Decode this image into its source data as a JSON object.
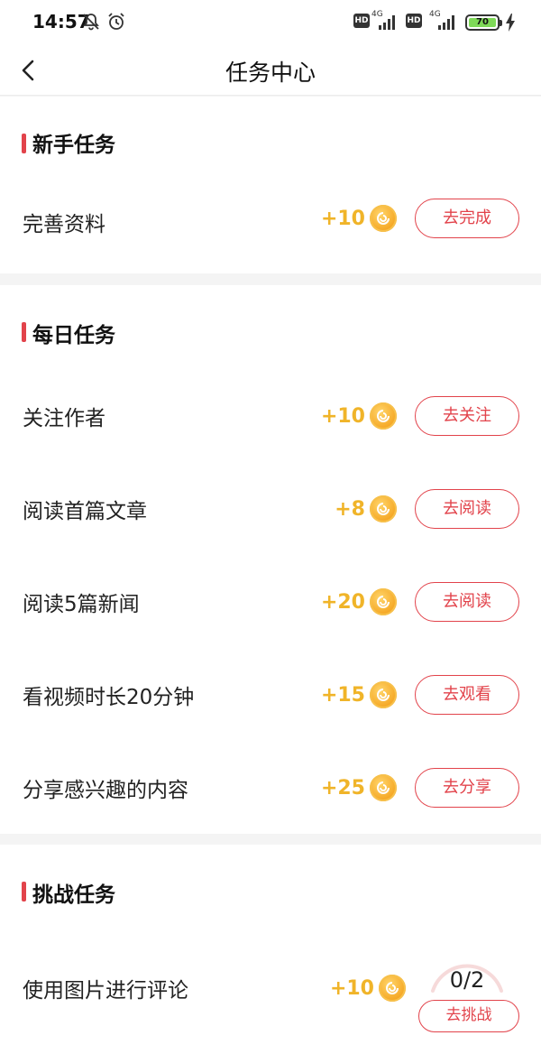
{
  "status_bar": {
    "time": "14:57",
    "network_1": "4G",
    "network_2": "4G",
    "hd_label": "HD",
    "battery": "70"
  },
  "nav": {
    "title": "任务中心"
  },
  "sections": [
    {
      "title": "新手任务",
      "tasks": [
        {
          "name": "完善资料",
          "reward": "+10",
          "button": "去完成"
        }
      ]
    },
    {
      "title": "每日任务",
      "tasks": [
        {
          "name": "关注作者",
          "reward": "+10",
          "button": "去关注"
        },
        {
          "name": "阅读首篇文章",
          "reward": "+8",
          "button": "去阅读"
        },
        {
          "name": "阅读5篇新闻",
          "reward": "+20",
          "button": "去阅读"
        },
        {
          "name": "看视频时长20分钟",
          "reward": "+15",
          "button": "去观看"
        },
        {
          "name": "分享感兴趣的内容",
          "reward": "+25",
          "button": "去分享"
        }
      ]
    },
    {
      "title": "挑战任务",
      "tasks": [
        {
          "name": "使用图片进行评论",
          "reward": "+10",
          "progress": "0/2",
          "button": "去挑战"
        }
      ]
    }
  ],
  "colors": {
    "accent": "#e2434b",
    "coin": "#f0b429"
  }
}
